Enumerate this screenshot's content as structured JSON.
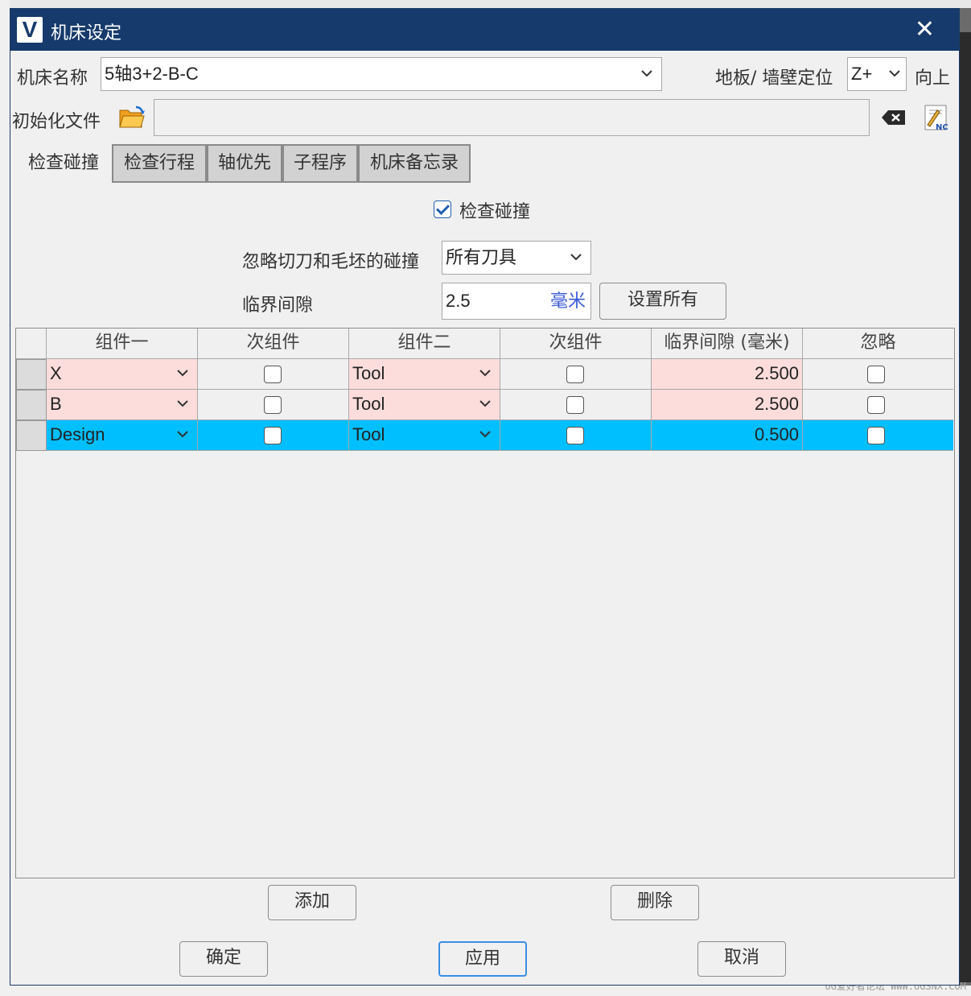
{
  "window": {
    "title": "机床设定",
    "logo_letter": "V",
    "close_glyph": "✕"
  },
  "machine": {
    "name_label": "机床名称",
    "name_value": "5轴3+2-B-C",
    "floor_label": "地板/ 墙壁定位",
    "floor_value": "Z+",
    "floor_suffix": "向上"
  },
  "init_file": {
    "label": "初始化文件",
    "value": ""
  },
  "tabs": [
    {
      "label": "检查碰撞",
      "active": true
    },
    {
      "label": "检查行程"
    },
    {
      "label": "轴优先"
    },
    {
      "label": "子程序"
    },
    {
      "label": "机床备忘录"
    }
  ],
  "collision": {
    "check_label": "检查碰撞",
    "check_checked": true,
    "ignore_label": "忽略切刀和毛坯的碰撞",
    "ignore_value": "所有刀具",
    "clearance_label": "临界间隙",
    "clearance_value": "2.5",
    "clearance_unit": "毫米",
    "set_all_label": "设置所有"
  },
  "table": {
    "headers": [
      "组件一",
      "次组件",
      "组件二",
      "次组件",
      "临界间隙 (毫米)",
      "忽略"
    ],
    "rows": [
      {
        "comp1": "X",
        "sub1": false,
        "comp2": "Tool",
        "sub2": false,
        "clearance": "2.500",
        "ignore": false
      },
      {
        "comp1": "B",
        "sub1": false,
        "comp2": "Tool",
        "sub2": false,
        "clearance": "2.500",
        "ignore": false
      },
      {
        "comp1": "Design",
        "sub1": false,
        "comp2": "Tool",
        "sub2": false,
        "clearance": "0.500",
        "ignore": false,
        "selected": true
      }
    ]
  },
  "buttons": {
    "add": "添加",
    "delete": "删除",
    "ok": "确定",
    "apply": "应用",
    "cancel": "取消"
  },
  "watermark": "UG爱好者论坛 WWW.UGSNX.COM",
  "colors": {
    "title_bar": "#163a6b",
    "row_highlight": "#00bfff",
    "error_cell": "#fddcdc",
    "unit_text": "#3b5bd9"
  }
}
